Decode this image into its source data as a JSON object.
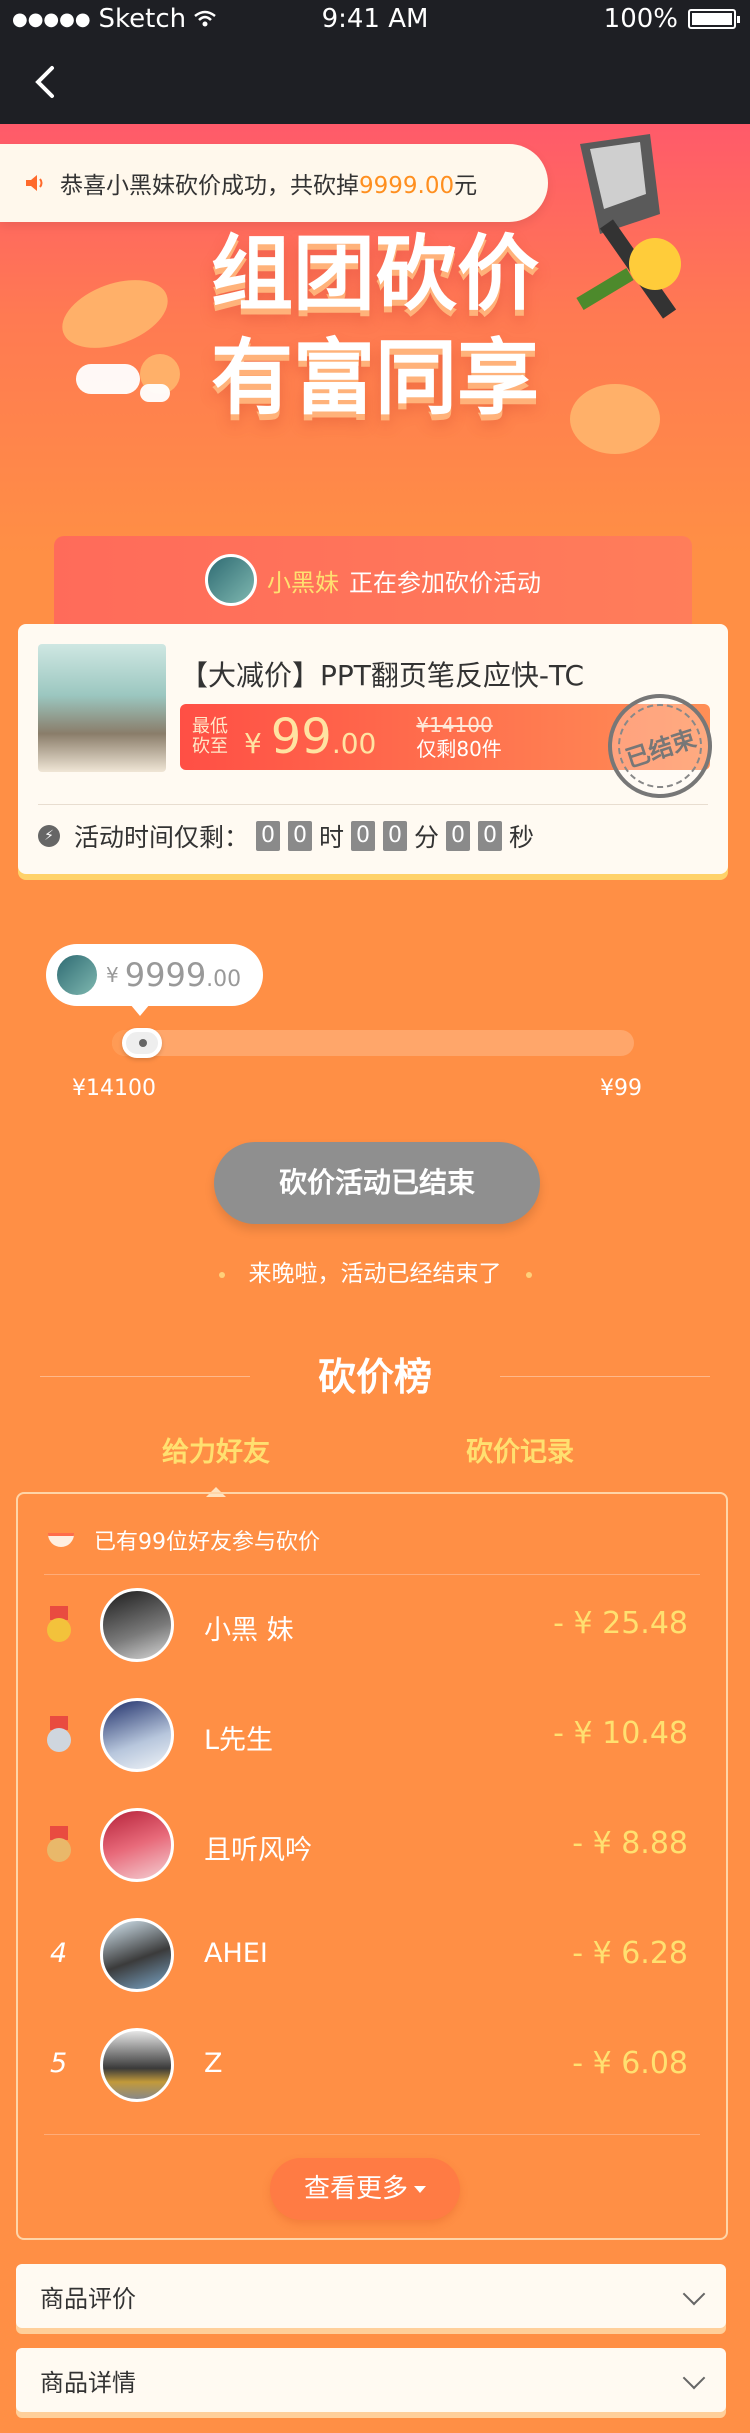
{
  "status_bar": {
    "carrier": "Sketch",
    "time": "9:41 AM",
    "battery": "100%"
  },
  "notice": {
    "text_prefix": "恭喜小黑妹砍价成功，共砍掉",
    "amount": "9999.00",
    "unit": "元"
  },
  "hero": {
    "title_line1": "组团砍价",
    "title_line2": "有富同享"
  },
  "participant": {
    "name": "小黑妹",
    "action": "正在参加砍价活动"
  },
  "product": {
    "title": "【大减价】PPT翻页笔反应快-TC",
    "price_label_1": "最低",
    "price_label_2": "砍至",
    "currency": "¥",
    "price_int": "99",
    "price_dec": ".00",
    "original_price": "¥14100",
    "stock": "仅剩80件",
    "stamp": "已结束",
    "timer_label": "活动时间仅剩：",
    "timer": {
      "h1": "0",
      "h2": "0",
      "h_unit": "时",
      "m1": "0",
      "m2": "0",
      "m_unit": "分",
      "s1": "0",
      "s2": "0",
      "s_unit": "秒"
    }
  },
  "progress": {
    "currency": "¥",
    "amount_int": "9999",
    "amount_dec": ".00",
    "fraction": 0.06,
    "min_label": "¥14100",
    "max_label": "¥99"
  },
  "status_button": "砍价活动已结束",
  "late_message": "来晚啦，活动已经结束了",
  "ranking": {
    "title": "砍价榜",
    "tabs": [
      "给力好友",
      "砍价记录"
    ],
    "friend_count_text": "已有99位好友参与砍价",
    "rows": [
      {
        "rank": "1",
        "name": "小黑 妹",
        "amount": "- ¥ 25.48"
      },
      {
        "rank": "2",
        "name": "L先生",
        "amount": "- ¥ 10.48"
      },
      {
        "rank": "3",
        "name": "且听风吟",
        "amount": "- ¥ 8.88"
      },
      {
        "rank": "4",
        "name": "AHEI",
        "amount": "- ¥ 6.28"
      },
      {
        "rank": "5",
        "name": "Z",
        "amount": "- ¥ 6.08"
      }
    ],
    "more_label": "查看更多"
  },
  "accordion": {
    "reviews": "商品评价",
    "details": "商品详情"
  },
  "colors": {
    "background": "#ff8f45",
    "accent_yellow": "#ffe070",
    "header_dark": "#1e1f24",
    "price_red": "#ff4f45"
  }
}
